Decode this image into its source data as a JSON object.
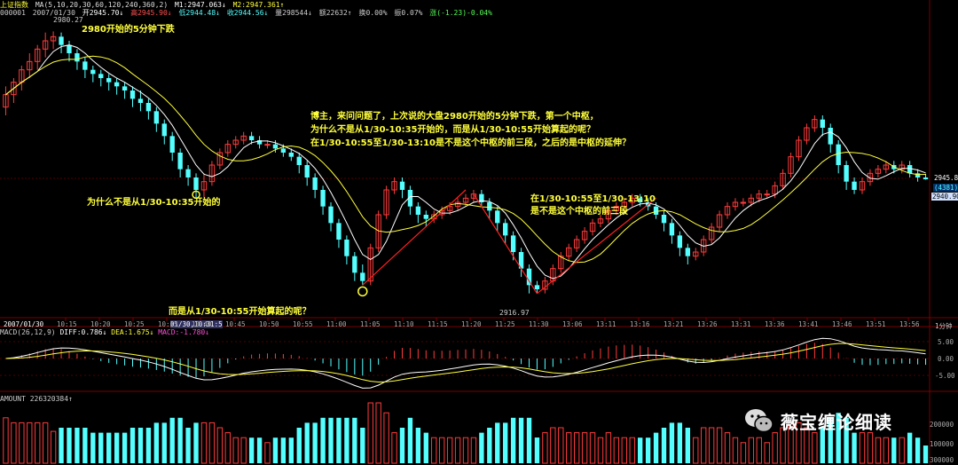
{
  "header": {
    "title": "上证指数",
    "ma_label": "MA(5,10,20,30,60,120,240,360,2)",
    "m1": "M1:2947.063↓",
    "m2": "M2:2947.361↑",
    "code": "000001",
    "date": "2007/01/30",
    "open": "开2945.70↓",
    "high": "高2945.90↓",
    "low": "低2944.48↓",
    "close": "收2944.56↓",
    "volume": "量298544↓",
    "amount": "额22632↑",
    "turnover": "换0.00%",
    "amplitude": "振0.07%",
    "change": "涨(-1.23)-0.04%"
  },
  "annotations": {
    "top": "2980开始的5分钟下跌",
    "why_not": "为什么不是从1/30-10:35开始的",
    "but_from": "而是从1/30-10:55开始算起的呢？",
    "question_1": "博主，来问问题了，上次说的大盘2980开始的5分钟下跌，第一个中枢，",
    "question_2": "为什么不是从1/30-10:35开始的，而是从1/30-10:55开始算起的呢？",
    "question_3": "在1/30-10:55至1/30-13:10是不是这个中枢的前三段，之后的是中枢的延伸？",
    "right_1": "在1/30-10:55至1/30-13:10",
    "right_2": "是不是这个中枢的前三段",
    "high_label": "2980.27",
    "low_label": "2916.97",
    "price_box_1": "2945.8",
    "price_box_2": "(4381)",
    "price_box_3": "2940.90"
  },
  "macd": {
    "label": "MACD(26,12,9)",
    "diff": "DIFF:0.786↓",
    "dea": "DEA:1.675↓",
    "macd": "MACD:-1.780↓",
    "axis": [
      "5.00",
      "0.00",
      "-5.00"
    ]
  },
  "volume": {
    "label": "AMOUNT 226320384↑",
    "axis": [
      "200000",
      "100000",
      "300000"
    ]
  },
  "time_axis": {
    "date_label": "2007/01/30",
    "period": "1分钟",
    "cursor_label": "01/30,10:31:5"
  },
  "watermark": "薇宝缠论细读",
  "colors": {
    "up": "#ff3b3b",
    "down": "#54ffff",
    "ma_white": "#ffffff",
    "ma_yellow": "#ffff3b",
    "annotation": "#ffff3b",
    "trend_line": "#ff2020",
    "grid": "#7a0000"
  },
  "chart_data": {
    "type": "candlestick",
    "time_ticks": [
      "10:15",
      "10:20",
      "10:25",
      "10:35",
      "10:40",
      "10:45",
      "10:50",
      "10:55",
      "11:00",
      "11:05",
      "11:10",
      "11:15",
      "11:20",
      "11:25",
      "11:30",
      "13:06",
      "13:11",
      "13:16",
      "13:21",
      "13:26",
      "13:31",
      "13:36",
      "13:41",
      "13:46",
      "13:51",
      "13:56"
    ],
    "price_high": 2980.27,
    "price_low": 2916.97,
    "last_price": 2945.8,
    "candles": [
      {
        "o": 2962,
        "c": 2965,
        "h": 2967,
        "l": 2960
      },
      {
        "o": 2965,
        "c": 2968,
        "h": 2969,
        "l": 2963
      },
      {
        "o": 2968,
        "c": 2971,
        "h": 2972,
        "l": 2966
      },
      {
        "o": 2971,
        "c": 2973,
        "h": 2975,
        "l": 2969
      },
      {
        "o": 2973,
        "c": 2976,
        "h": 2977,
        "l": 2971
      },
      {
        "o": 2976,
        "c": 2978,
        "h": 2980,
        "l": 2974
      },
      {
        "o": 2978,
        "c": 2979,
        "h": 2980.27,
        "l": 2976
      },
      {
        "o": 2979,
        "c": 2977,
        "h": 2980,
        "l": 2975
      },
      {
        "o": 2977,
        "c": 2975,
        "h": 2978,
        "l": 2973
      },
      {
        "o": 2975,
        "c": 2973,
        "h": 2976,
        "l": 2971
      },
      {
        "o": 2973,
        "c": 2971,
        "h": 2974,
        "l": 2969
      },
      {
        "o": 2971,
        "c": 2970,
        "h": 2972,
        "l": 2968
      },
      {
        "o": 2970,
        "c": 2969,
        "h": 2971,
        "l": 2967
      },
      {
        "o": 2969,
        "c": 2968,
        "h": 2970,
        "l": 2966
      },
      {
        "o": 2968,
        "c": 2967,
        "h": 2969,
        "l": 2965
      },
      {
        "o": 2967,
        "c": 2966,
        "h": 2968,
        "l": 2964
      },
      {
        "o": 2966,
        "c": 2964,
        "h": 2967,
        "l": 2962
      },
      {
        "o": 2964,
        "c": 2963,
        "h": 2966,
        "l": 2961
      },
      {
        "o": 2963,
        "c": 2961,
        "h": 2964,
        "l": 2959
      },
      {
        "o": 2961,
        "c": 2958,
        "h": 2962,
        "l": 2956
      },
      {
        "o": 2958,
        "c": 2955,
        "h": 2959,
        "l": 2953
      },
      {
        "o": 2955,
        "c": 2951,
        "h": 2956,
        "l": 2949
      },
      {
        "o": 2951,
        "c": 2947,
        "h": 2952,
        "l": 2945
      },
      {
        "o": 2947,
        "c": 2945,
        "h": 2948,
        "l": 2943
      },
      {
        "o": 2945,
        "c": 2942,
        "h": 2946,
        "l": 2940
      },
      {
        "o": 2942,
        "c": 2944,
        "h": 2946,
        "l": 2940
      },
      {
        "o": 2944,
        "c": 2948,
        "h": 2949,
        "l": 2943
      },
      {
        "o": 2948,
        "c": 2951,
        "h": 2952,
        "l": 2947
      },
      {
        "o": 2951,
        "c": 2953,
        "h": 2954,
        "l": 2950
      },
      {
        "o": 2953,
        "c": 2954,
        "h": 2955,
        "l": 2952
      },
      {
        "o": 2954,
        "c": 2955,
        "h": 2956,
        "l": 2953
      },
      {
        "o": 2955,
        "c": 2954,
        "h": 2956,
        "l": 2953
      },
      {
        "o": 2954,
        "c": 2953,
        "h": 2955,
        "l": 2952
      },
      {
        "o": 2953,
        "c": 2953,
        "h": 2954,
        "l": 2952
      },
      {
        "o": 2953,
        "c": 2952,
        "h": 2954,
        "l": 2951
      },
      {
        "o": 2952,
        "c": 2951,
        "h": 2953,
        "l": 2950
      },
      {
        "o": 2951,
        "c": 2950,
        "h": 2952,
        "l": 2949
      },
      {
        "o": 2950,
        "c": 2948,
        "h": 2951,
        "l": 2946
      },
      {
        "o": 2948,
        "c": 2945,
        "h": 2949,
        "l": 2943
      },
      {
        "o": 2945,
        "c": 2942,
        "h": 2946,
        "l": 2940
      },
      {
        "o": 2942,
        "c": 2938,
        "h": 2943,
        "l": 2936
      },
      {
        "o": 2938,
        "c": 2934,
        "h": 2939,
        "l": 2932
      },
      {
        "o": 2934,
        "c": 2930,
        "h": 2935,
        "l": 2928
      },
      {
        "o": 2930,
        "c": 2926,
        "h": 2931,
        "l": 2924
      },
      {
        "o": 2926,
        "c": 2922,
        "h": 2927,
        "l": 2920
      },
      {
        "o": 2922,
        "c": 2920,
        "h": 2924,
        "l": 2919
      },
      {
        "o": 2920,
        "c": 2928,
        "h": 2929,
        "l": 2919
      },
      {
        "o": 2928,
        "c": 2936,
        "h": 2937,
        "l": 2927
      },
      {
        "o": 2936,
        "c": 2942,
        "h": 2943,
        "l": 2935
      },
      {
        "o": 2942,
        "c": 2944,
        "h": 2945,
        "l": 2941
      },
      {
        "o": 2944,
        "c": 2942,
        "h": 2945,
        "l": 2940
      },
      {
        "o": 2942,
        "c": 2938,
        "h": 2943,
        "l": 2936
      },
      {
        "o": 2938,
        "c": 2936,
        "h": 2939,
        "l": 2934
      },
      {
        "o": 2936,
        "c": 2935,
        "h": 2937,
        "l": 2933
      },
      {
        "o": 2935,
        "c": 2936,
        "h": 2937,
        "l": 2934
      },
      {
        "o": 2936,
        "c": 2937,
        "h": 2938,
        "l": 2935
      },
      {
        "o": 2937,
        "c": 2938,
        "h": 2939,
        "l": 2936
      },
      {
        "o": 2938,
        "c": 2939,
        "h": 2940,
        "l": 2937
      },
      {
        "o": 2939,
        "c": 2940,
        "h": 2941,
        "l": 2938
      },
      {
        "o": 2940,
        "c": 2941,
        "h": 2942,
        "l": 2939
      },
      {
        "o": 2941,
        "c": 2939,
        "h": 2942,
        "l": 2938
      },
      {
        "o": 2939,
        "c": 2937,
        "h": 2940,
        "l": 2935
      },
      {
        "o": 2937,
        "c": 2934,
        "h": 2938,
        "l": 2932
      },
      {
        "o": 2934,
        "c": 2931,
        "h": 2935,
        "l": 2929
      },
      {
        "o": 2931,
        "c": 2927,
        "h": 2932,
        "l": 2925
      },
      {
        "o": 2927,
        "c": 2923,
        "h": 2928,
        "l": 2921
      },
      {
        "o": 2923,
        "c": 2919,
        "h": 2924,
        "l": 2917
      },
      {
        "o": 2919,
        "c": 2918,
        "h": 2920,
        "l": 2916.97
      },
      {
        "o": 2918,
        "c": 2920,
        "h": 2921,
        "l": 2917
      },
      {
        "o": 2920,
        "c": 2923,
        "h": 2924,
        "l": 2919
      },
      {
        "o": 2923,
        "c": 2926,
        "h": 2927,
        "l": 2922
      },
      {
        "o": 2926,
        "c": 2928,
        "h": 2929,
        "l": 2925
      },
      {
        "o": 2928,
        "c": 2930,
        "h": 2931,
        "l": 2927
      },
      {
        "o": 2930,
        "c": 2932,
        "h": 2933,
        "l": 2929
      },
      {
        "o": 2932,
        "c": 2934,
        "h": 2935,
        "l": 2931
      },
      {
        "o": 2934,
        "c": 2935,
        "h": 2936,
        "l": 2933
      },
      {
        "o": 2935,
        "c": 2937,
        "h": 2938,
        "l": 2934
      },
      {
        "o": 2937,
        "c": 2938,
        "h": 2939,
        "l": 2936
      },
      {
        "o": 2938,
        "c": 2939,
        "h": 2940,
        "l": 2937
      },
      {
        "o": 2939,
        "c": 2940,
        "h": 2941,
        "l": 2938
      },
      {
        "o": 2940,
        "c": 2939,
        "h": 2941,
        "l": 2938
      },
      {
        "o": 2939,
        "c": 2938,
        "h": 2940,
        "l": 2937
      },
      {
        "o": 2938,
        "c": 2936,
        "h": 2939,
        "l": 2935
      },
      {
        "o": 2936,
        "c": 2934,
        "h": 2937,
        "l": 2932
      },
      {
        "o": 2934,
        "c": 2931,
        "h": 2935,
        "l": 2929
      },
      {
        "o": 2931,
        "c": 2928,
        "h": 2932,
        "l": 2926
      },
      {
        "o": 2928,
        "c": 2926,
        "h": 2929,
        "l": 2924
      },
      {
        "o": 2926,
        "c": 2927,
        "h": 2928,
        "l": 2925
      },
      {
        "o": 2927,
        "c": 2930,
        "h": 2931,
        "l": 2926
      },
      {
        "o": 2930,
        "c": 2933,
        "h": 2934,
        "l": 2929
      },
      {
        "o": 2933,
        "c": 2936,
        "h": 2937,
        "l": 2932
      },
      {
        "o": 2936,
        "c": 2938,
        "h": 2939,
        "l": 2935
      },
      {
        "o": 2938,
        "c": 2939,
        "h": 2940,
        "l": 2937
      },
      {
        "o": 2939,
        "c": 2939,
        "h": 2940,
        "l": 2938
      },
      {
        "o": 2939,
        "c": 2940,
        "h": 2941,
        "l": 2938
      },
      {
        "o": 2940,
        "c": 2941,
        "h": 2942,
        "l": 2939
      },
      {
        "o": 2941,
        "c": 2941,
        "h": 2942,
        "l": 2940
      },
      {
        "o": 2941,
        "c": 2943,
        "h": 2944,
        "l": 2940
      },
      {
        "o": 2943,
        "c": 2946,
        "h": 2947,
        "l": 2942
      },
      {
        "o": 2946,
        "c": 2950,
        "h": 2951,
        "l": 2945
      },
      {
        "o": 2950,
        "c": 2954,
        "h": 2955,
        "l": 2949
      },
      {
        "o": 2954,
        "c": 2957,
        "h": 2958,
        "l": 2953
      },
      {
        "o": 2957,
        "c": 2959,
        "h": 2960,
        "l": 2956
      },
      {
        "o": 2959,
        "c": 2957,
        "h": 2960,
        "l": 2955
      },
      {
        "o": 2957,
        "c": 2953,
        "h": 2958,
        "l": 2951
      },
      {
        "o": 2953,
        "c": 2948,
        "h": 2954,
        "l": 2946
      },
      {
        "o": 2948,
        "c": 2944,
        "h": 2949,
        "l": 2942
      },
      {
        "o": 2944,
        "c": 2942,
        "h": 2945,
        "l": 2941
      },
      {
        "o": 2942,
        "c": 2944,
        "h": 2945,
        "l": 2941
      },
      {
        "o": 2944,
        "c": 2946,
        "h": 2947,
        "l": 2943
      },
      {
        "o": 2946,
        "c": 2947,
        "h": 2948,
        "l": 2945
      },
      {
        "o": 2947,
        "c": 2948,
        "h": 2949,
        "l": 2946
      },
      {
        "o": 2948,
        "c": 2947,
        "h": 2949,
        "l": 2946
      },
      {
        "o": 2947,
        "c": 2948,
        "h": 2949,
        "l": 2946
      },
      {
        "o": 2948,
        "c": 2946,
        "h": 2949,
        "l": 2945
      },
      {
        "o": 2946,
        "c": 2945,
        "h": 2947,
        "l": 2944
      },
      {
        "o": 2945,
        "c": 2944.56,
        "h": 2945.9,
        "l": 2944.48
      }
    ]
  }
}
